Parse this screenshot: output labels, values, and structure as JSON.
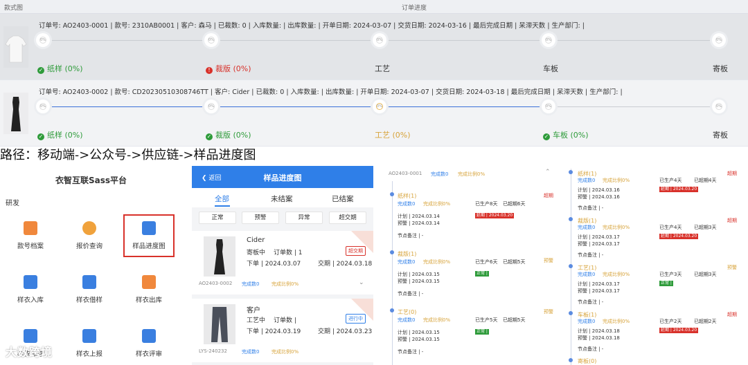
{
  "table": {
    "col_style": "款式图",
    "col_progress": "订单进度",
    "rows": [
      {
        "info": "订单号: AO2403-0001 | 款号: 2310AB0001 | 客户: 森马 | 已裁数: 0 | 入库数量: | 出库数量: | 开单日期: 2024-03-07 | 交货日期: 2024-03-16 | 最后完成日期 | 呆滞天数 | 生产部门: |",
        "nodes": [
          "0%",
          "0%",
          "0%",
          "0%",
          "0%"
        ],
        "stages": [
          {
            "status": "ok",
            "label": "纸样",
            "pct": "(0%)"
          },
          {
            "status": "alert",
            "label": "裁版",
            "pct": "(0%)"
          },
          {
            "status": "none",
            "label": "工艺",
            "pct": ""
          },
          {
            "status": "none",
            "label": "车板",
            "pct": ""
          },
          {
            "status": "none",
            "label": "寄板",
            "pct": ""
          }
        ]
      },
      {
        "info": "订单号: AO2403-0002 | 款号: CD20230510308746TT | 客户: Cider | 已裁数: 0 | 入库数量: | 出库数量: | 开单日期: 2024-03-07 | 交货日期: 2024-03-18 | 最后完成日期 | 呆滞天数 | 生产部门: |",
        "nodes": [
          "0%",
          "0%",
          "0%",
          "0%",
          "0%"
        ],
        "stages": [
          {
            "status": "ok",
            "label": "纸样",
            "pct": "(0%)"
          },
          {
            "status": "ok",
            "label": "裁版",
            "pct": "(0%)"
          },
          {
            "status": "warn",
            "label": "工艺",
            "pct": "(0%)"
          },
          {
            "status": "ok",
            "label": "车板",
            "pct": "(0%)"
          },
          {
            "status": "none",
            "label": "寄板",
            "pct": ""
          }
        ]
      }
    ]
  },
  "caption": "路径：移动端->公众号->供应链->样品进度图",
  "mobile_menu": {
    "title": "衣智互联Sass平台",
    "section": "研发",
    "items": [
      {
        "label": "款号档案",
        "icon": "document-icon",
        "color": "#f0883c"
      },
      {
        "label": "报价查询",
        "icon": "magnifier-icon",
        "color": "#f0a23c"
      },
      {
        "label": "样品进度图",
        "icon": "progress-chart-icon",
        "color": "#3a7fe0"
      },
      {
        "label": "样衣入库",
        "icon": "shirt-in-icon",
        "color": "#3a7fe0"
      },
      {
        "label": "样衣借样",
        "icon": "shirt-borrow-icon",
        "color": "#3a7fe0"
      },
      {
        "label": "样衣出库",
        "icon": "shirt-out-icon",
        "color": "#f0883c"
      },
      {
        "label": "样衣库存",
        "icon": "shirt-stock-icon",
        "color": "#3a7fe0"
      },
      {
        "label": "样衣上报",
        "icon": "shirt-report-icon",
        "color": "#3a7fe0"
      },
      {
        "label": "样衣评审",
        "icon": "shirt-review-icon",
        "color": "#3a7fe0"
      }
    ]
  },
  "mobile_list": {
    "back": "返回",
    "title": "样品进度图",
    "tabs": [
      "全部",
      "未结案",
      "已结案"
    ],
    "filters": [
      "正常",
      "预警",
      "异常",
      "超交期"
    ],
    "cards": [
      {
        "customer": "Cider",
        "status": "寄板中",
        "order_count": "订单数 | 1",
        "order_date": "下单 | 2024.03.07",
        "delivery": "交期 | 2024.03.18",
        "tag": "超交期",
        "code": "AO2403-0002",
        "done": "完成数0",
        "ratio": "完成比例0%"
      },
      {
        "customer": "客户",
        "status": "工艺中",
        "order_count": "订单数 |",
        "order_date": "下单 | 2024.03.19",
        "delivery": "交期 | 2024.03.23",
        "tag": "进行中",
        "code": "LYS-240232",
        "done": "完成数0",
        "ratio": "完成比例0%"
      }
    ]
  },
  "detail_left": {
    "code": "AO2403-0001",
    "done": "完成数0",
    "ratio": "完成比例0%",
    "steps": [
      {
        "name": "纸样(1)",
        "done": "完成数0",
        "ratio": "完成比例0%",
        "produced": "已生产8天",
        "over": "已超期6天",
        "flag": "超期",
        "plan": "计划 | 2024.03.14",
        "warn": "预警 | 2024.03.14",
        "tag": "延期 | 2024.03.20",
        "tag_type": "red",
        "note": "节点备注 | -"
      },
      {
        "name": "裁版(1)",
        "done": "完成数0",
        "ratio": "完成比例0%",
        "produced": "已生产6天",
        "over": "已超期5天",
        "flag": "预警",
        "plan": "计划 | 2024.03.15",
        "warn": "预警 | 2024.03.15",
        "tag": "正常 |",
        "tag_type": "green",
        "note": "节点备注 | -"
      },
      {
        "name": "工艺(0)",
        "done": "完成数0",
        "ratio": "完成比例0%",
        "produced": "已生产5天",
        "over": "已超期5天",
        "flag": "预警",
        "plan": "计划 | 2024.03.15",
        "warn": "预警 | 2024.03.15",
        "tag": "正常 |",
        "tag_type": "green",
        "note": "节点备注 | -"
      }
    ]
  },
  "detail_right": {
    "steps": [
      {
        "name": "纸样(1)",
        "done": "完成数0",
        "ratio": "完成比例0%",
        "produced": "已生产4天",
        "over": "已超期4天",
        "flag": "超期",
        "plan": "计划 | 2024.03.16",
        "warn": "预警 | 2024.03.16",
        "tag": "延期 | 2024.03.20",
        "tag_type": "red",
        "note": "节点备注 | -"
      },
      {
        "name": "裁版(1)",
        "done": "完成数0",
        "ratio": "完成比例0%",
        "produced": "已生产4天",
        "over": "已超期3天",
        "flag": "超期",
        "plan": "计划 | 2024.03.17",
        "warn": "预警 | 2024.03.17",
        "tag": "延期 | 2024.03.20",
        "tag_type": "red",
        "note": "节点备注 | -"
      },
      {
        "name": "工艺(1)",
        "done": "完成数0",
        "ratio": "完成比例0%",
        "produced": "已生产3天",
        "over": "已超期3天",
        "flag": "预警",
        "plan": "计划 | 2024.03.17",
        "warn": "预警 | 2024.03.17",
        "tag": "正常 |",
        "tag_type": "green",
        "note": "节点备注 | -"
      },
      {
        "name": "车板(1)",
        "done": "完成数0",
        "ratio": "完成比例0%",
        "produced": "已生产2天",
        "over": "已超期2天",
        "flag": "超期",
        "plan": "计划 | 2024.03.18",
        "warn": "预警 | 2024.03.18",
        "tag": "延期 | 2024.03.20",
        "tag_type": "red",
        "note": "节点备注 | -"
      }
    ],
    "last_step": "寄板(0)"
  },
  "watermark": "大数跨境",
  "colors": {
    "accent": "#2f7fe8",
    "ok": "#2e9b3a",
    "alert": "#d8312a",
    "warn": "#d7a33a"
  }
}
